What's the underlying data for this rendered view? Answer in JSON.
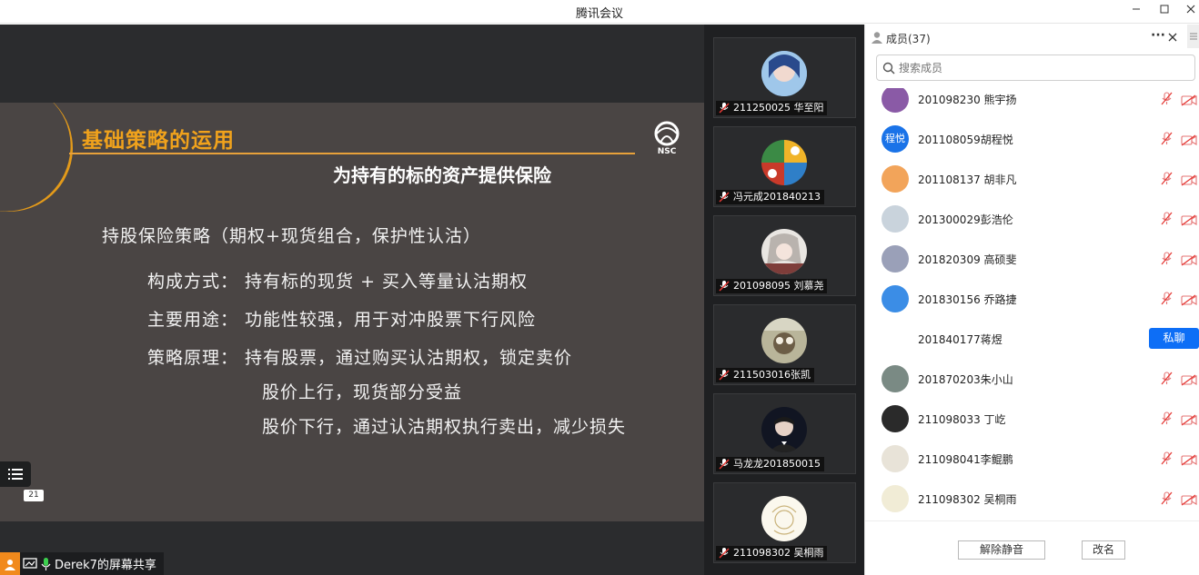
{
  "window": {
    "title": "腾讯会议"
  },
  "slide": {
    "heading": "基础策略的运用",
    "subheading": "为持有的标的资产提供保险",
    "logo_text": "NSC",
    "lines": [
      "持股保险策略（期权+现货组合，保护性认沽）",
      "构成方式：  持有标的现货 + 买入等量认沽期权",
      "主要用途：  功能性较强，用于对冲股票下行风险",
      "策略原理：  持有股票，通过购买认沽期权，锁定卖价",
      "股价上行，现货部分受益",
      "股价下行，通过认沽期权执行卖出，减少损失"
    ],
    "page_number": "21"
  },
  "share_bar": {
    "label": "Derek7的屏幕共享"
  },
  "video_tiles": [
    {
      "name": "211250025 华至阳",
      "avatar_color": "#5a8fc7"
    },
    {
      "name": "冯元成201840213",
      "avatar_color": "#2f7d3a"
    },
    {
      "name": "201098095 刘慕尧",
      "avatar_color": "#d8d3cf"
    },
    {
      "name": "211503016张凯",
      "avatar_color": "#7e7a62"
    },
    {
      "name": "马龙龙201850015",
      "avatar_color": "#0d0f1a"
    },
    {
      "name": "211098302 吴桐雨",
      "avatar_color": "#f4f0e0"
    }
  ],
  "panel": {
    "title": "成员(37)",
    "more": "···",
    "search_placeholder": "搜索成员",
    "members": [
      {
        "name": "201098230 熊宇扬",
        "avatar_color": "#8a5aa6",
        "avatar_text": ""
      },
      {
        "name": "201108059胡程悦",
        "avatar_color": "#1a73e8",
        "avatar_text": "程悦"
      },
      {
        "name": "201108137 胡非凡",
        "avatar_color": "#f2a45a",
        "avatar_text": ""
      },
      {
        "name": "201300029彭浩伦",
        "avatar_color": "#c9d3dc",
        "avatar_text": ""
      },
      {
        "name": "201820309 高硕斐",
        "avatar_color": "#9aa0b8",
        "avatar_text": ""
      },
      {
        "name": "201830156 乔路捷",
        "avatar_color": "#3b8de6",
        "avatar_text": ""
      },
      {
        "name": "201840177蒋煜",
        "avatar_color": "",
        "avatar_text": ""
      },
      {
        "name": "201870203朱小山",
        "avatar_color": "#7a8a84",
        "avatar_text": ""
      },
      {
        "name": "211098033 丁屹",
        "avatar_color": "#2a2a2a",
        "avatar_text": ""
      },
      {
        "name": "211098041李鲲鹏",
        "avatar_color": "#e8e3d8",
        "avatar_text": ""
      },
      {
        "name": "211098302 吴桐雨",
        "avatar_color": "#f1ecd6",
        "avatar_text": ""
      }
    ],
    "private_chat_label": "私聊",
    "unmute_label": "解除静音",
    "rename_label": "改名"
  }
}
